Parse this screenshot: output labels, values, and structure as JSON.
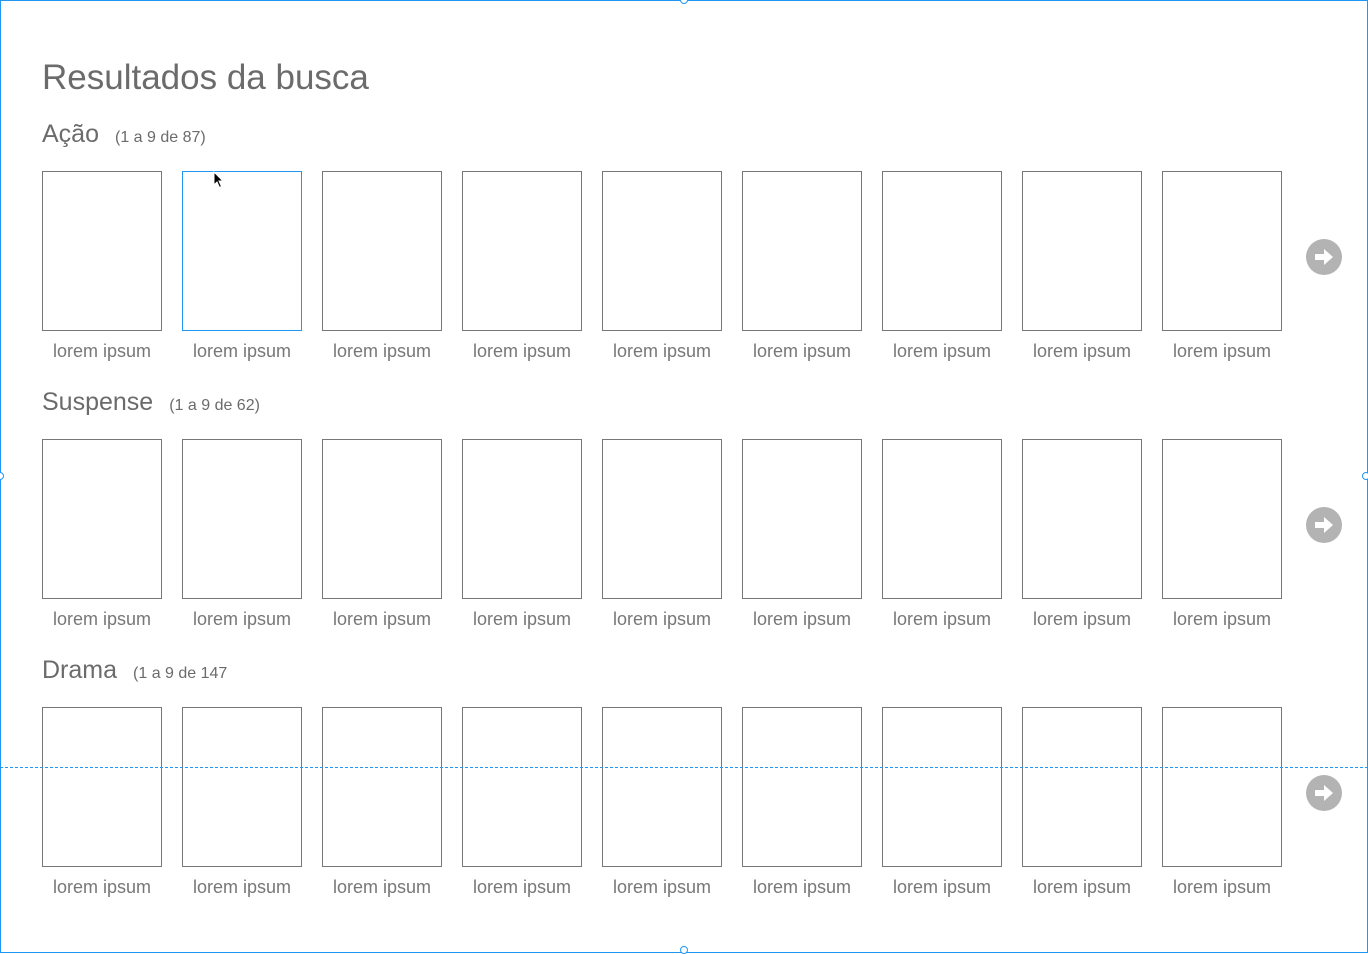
{
  "page": {
    "title": "Resultados da busca"
  },
  "colors": {
    "selection": "#2196f3",
    "border": "#777777",
    "arrow": "#b3b3b3"
  },
  "sections": [
    {
      "name": "Ação",
      "count": "(1 a 9 de 87)",
      "items": [
        "lorem ipsum",
        "lorem ipsum",
        "lorem ipsum",
        "lorem ipsum",
        "lorem ipsum",
        "lorem ipsum",
        "lorem ipsum",
        "lorem ipsum",
        "lorem ipsum"
      ],
      "next_icon": "arrow-right-circle-icon"
    },
    {
      "name": "Suspense",
      "count": "(1 a 9 de 62)",
      "items": [
        "lorem ipsum",
        "lorem ipsum",
        "lorem ipsum",
        "lorem ipsum",
        "lorem ipsum",
        "lorem ipsum",
        "lorem ipsum",
        "lorem ipsum",
        "lorem ipsum"
      ],
      "next_icon": "arrow-right-circle-icon"
    },
    {
      "name": "Drama",
      "count": "(1 a 9 de 147",
      "items": [
        "lorem ipsum",
        "lorem ipsum",
        "lorem ipsum",
        "lorem ipsum",
        "lorem ipsum",
        "lorem ipsum",
        "lorem ipsum",
        "lorem ipsum",
        "lorem ipsum"
      ],
      "next_icon": "arrow-right-circle-icon"
    }
  ]
}
